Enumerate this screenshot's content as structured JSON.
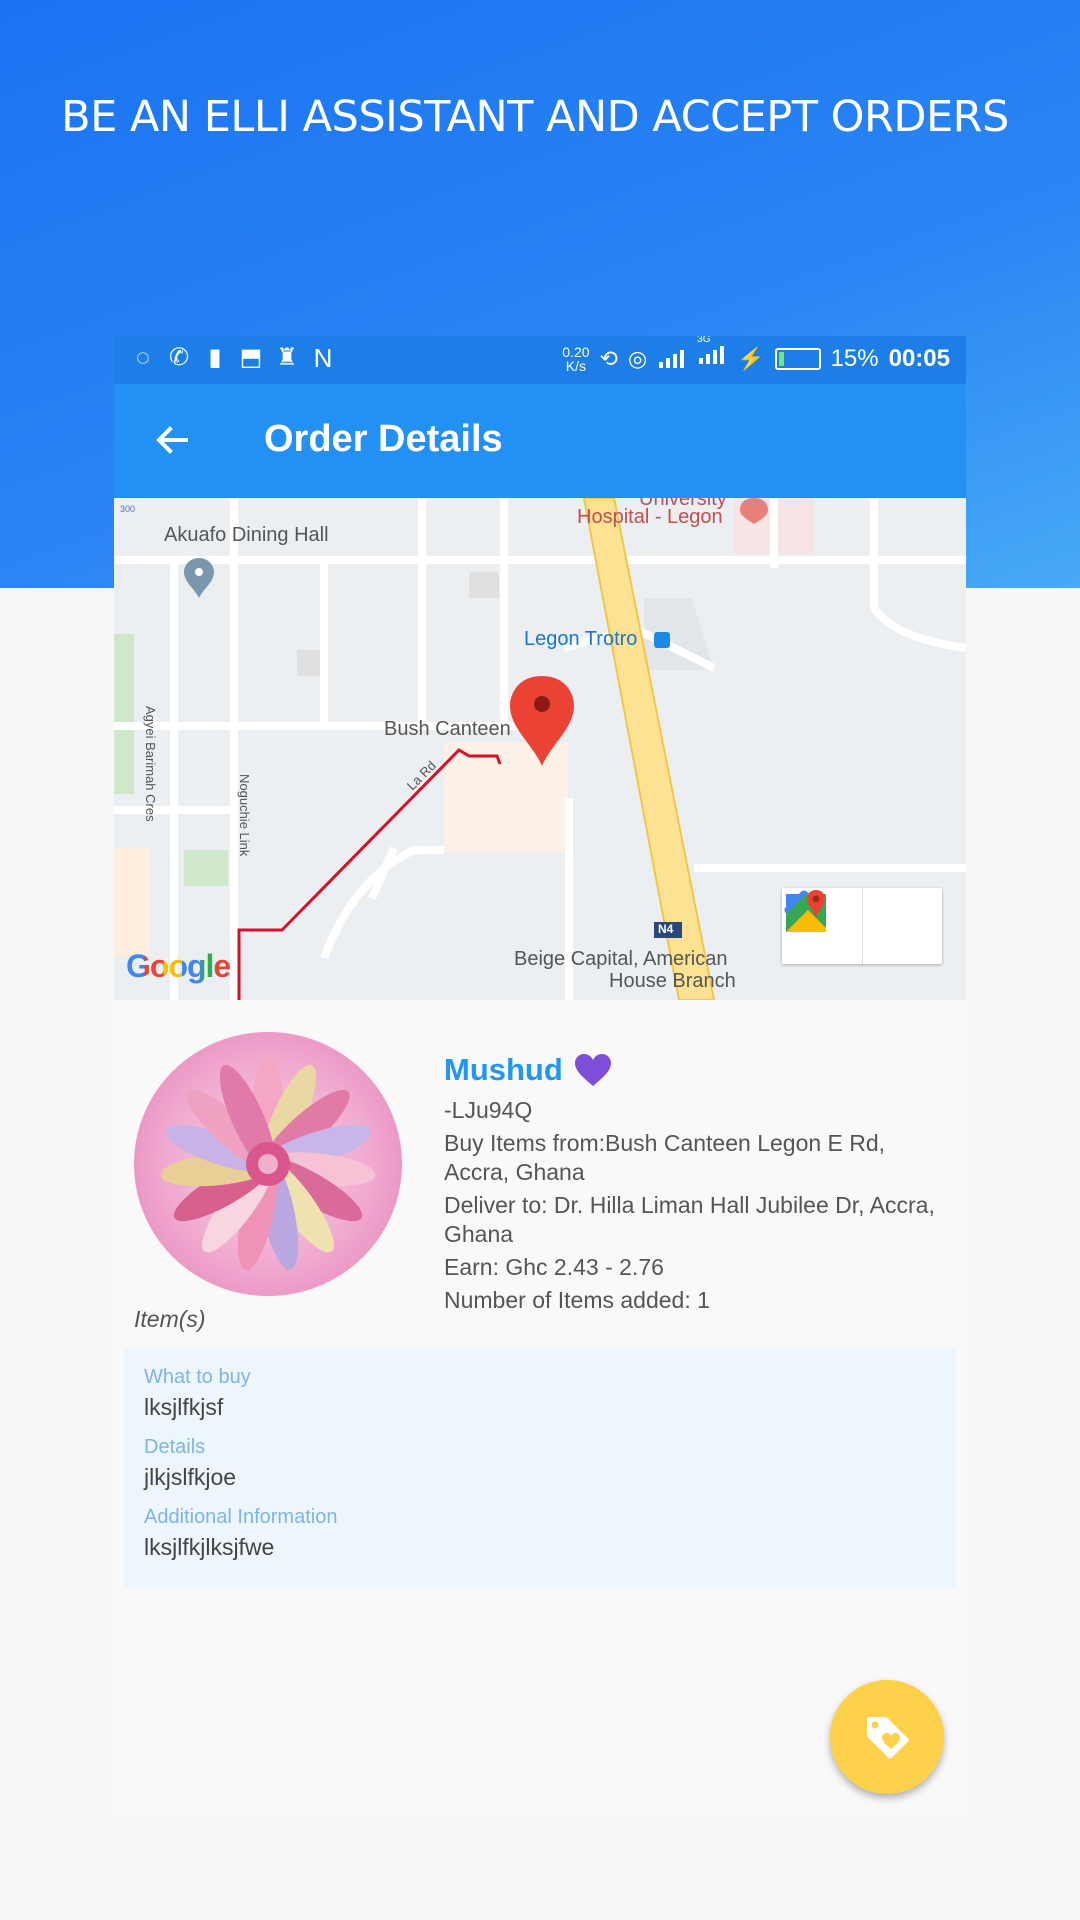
{
  "hero": {
    "title": "BE AN ELLI ASSISTANT AND ACCEPT ORDERS"
  },
  "statusbar": {
    "left_icons": [
      "sync-icon",
      "whatsapp-icon",
      "sim-icon",
      "download-icon",
      "cleaner-icon",
      "n-icon"
    ],
    "speed_value": "0.20",
    "speed_unit": "K/s",
    "network": "3G",
    "battery_percent": "15%",
    "time": "00:05"
  },
  "appbar": {
    "title": "Order Details",
    "back_icon": "arrow-left-icon"
  },
  "map": {
    "labels": {
      "akuafo": "Akuafo Dining Hall",
      "hospital_top": "University",
      "hospital": "Hospital - Legon",
      "trotro": "Legon Trotro",
      "bush_canteen": "Bush Canteen",
      "agyei": "Agyei Barimah Cres",
      "noguchie": "Noguchie Link",
      "road_la": "La Rd",
      "n4": "N4",
      "beige_1": "Beige Capital, American",
      "beige_2": "House Branch",
      "google": "Google",
      "stop_300": "300"
    },
    "buttons": [
      "directions-icon",
      "google-maps-icon"
    ]
  },
  "order": {
    "name": "Mushud",
    "code": "-LJu94Q",
    "buy_from": "Buy Items from:Bush Canteen Legon E Rd, Accra, Ghana",
    "deliver_to": "Deliver to: Dr. Hilla Liman Hall Jubilee Dr, Accra, Ghana",
    "earn": "Earn: Ghc 2.43 - 2.76",
    "items_count": "Number of Items added: 1",
    "items_label": "Item(s)"
  },
  "item": {
    "what_label": "What to buy",
    "what_value": "lksjlfkjsf",
    "details_label": "Details",
    "details_value": "jlkjslfkjoe",
    "additional_label": "Additional Information",
    "additional_value": "lksjlfkjlksjfwe"
  },
  "colors": {
    "primary": "#2391f4",
    "statusbar": "#1c7ee6",
    "name": "#2196f3",
    "heart": "#7e4fd6",
    "fab": "#fdd14a",
    "route": "#d4102a",
    "pin": "#ea4335"
  },
  "fab": {
    "icon": "tag-heart-icon"
  }
}
